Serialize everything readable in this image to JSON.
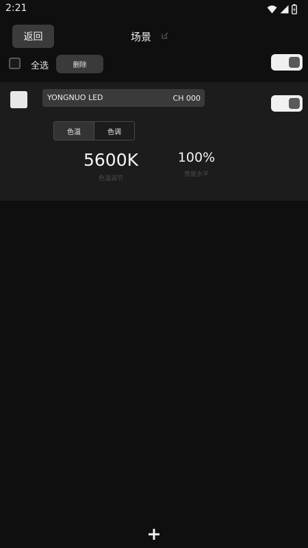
{
  "status_bar": {
    "time": "2:21",
    "icons": [
      "wifi-icon",
      "cell-signal-icon",
      "battery-icon"
    ]
  },
  "header": {
    "back_label": "返回",
    "title": "场景",
    "edit_icon": "edit-icon"
  },
  "toolbar": {
    "select_all_label": "全选",
    "select_all_checked": false,
    "delete_label": "删除",
    "master_toggle_on": true
  },
  "device": {
    "name": "YONGNUO LED",
    "channel": "CH 000",
    "selected": false,
    "power_on": true,
    "mode_tabs": [
      {
        "label": "色温",
        "active": true
      },
      {
        "label": "色调",
        "active": false
      }
    ],
    "cct": {
      "value": "5600K",
      "label": "色温调节"
    },
    "brightness": {
      "value": "100%",
      "label": "亮度水平"
    }
  },
  "footer": {
    "add_icon": "plus-icon"
  },
  "colors": {
    "background": "#0f0f0f",
    "card": "#1c1c1c",
    "button": "#3b3b3b",
    "toggle_track": "#f0f0f0",
    "toggle_knob": "#5a5a5a"
  }
}
